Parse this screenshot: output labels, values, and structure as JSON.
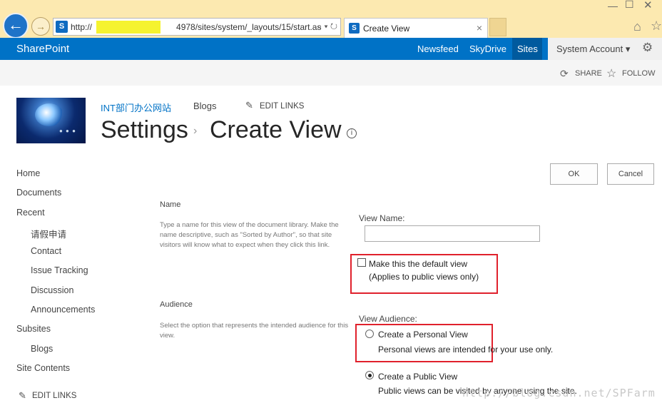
{
  "browser": {
    "address": "http://",
    "address_suffix": "4978/sites/system/_layouts/15/start.as",
    "address_controls": "⌕ ▾ ↻",
    "tab_title": "Create View",
    "tab_close": "×"
  },
  "suite": {
    "brand": "SharePoint",
    "links": [
      "Newsfeed",
      "SkyDrive",
      "Sites"
    ],
    "account": "System Account ▾"
  },
  "ribbon": {
    "share": "SHARE",
    "follow": "FOLLOW"
  },
  "site": {
    "site_name": "INT部门办公网站",
    "blogs": "Blogs",
    "edit_links": "EDIT LINKS",
    "title_1": "Settings",
    "title_sep": "›",
    "title_2": "Create View",
    "info": "i"
  },
  "nav": {
    "items": [
      "Home",
      "Documents",
      "Recent",
      "请假申请",
      "Contact",
      "Issue Tracking",
      "Discussion",
      "Announcements",
      "Subsites",
      "Blogs",
      "Site Contents"
    ],
    "edit_links": "EDIT LINKS"
  },
  "buttons": {
    "ok": "OK",
    "cancel": "Cancel"
  },
  "form": {
    "name_title": "Name",
    "name_desc": "Type a name for this view of the document library. Make the name descriptive, such as \"Sorted by Author\", so that site visitors will know what to expect when they click this link.",
    "view_name_label": "View Name:",
    "view_name_value": "",
    "default_label": "Make this the default view",
    "default_sub": "(Applies to public views only)",
    "default_checked": false,
    "audience_title": "Audience",
    "audience_desc": "Select the option that represents the intended audience for this view.",
    "audience_label": "View Audience:",
    "personal_label": "Create a Personal View",
    "personal_desc": "Personal views are intended for your use only.",
    "public_label": "Create a Public View",
    "public_desc": "Public views can be visited by anyone using the site.",
    "selected_audience": "public"
  },
  "watermark": "http://blog.csdn.net/SPFarm",
  "colors": {
    "suite_blue": "#0072c6",
    "highlight_red": "#e0212c"
  }
}
